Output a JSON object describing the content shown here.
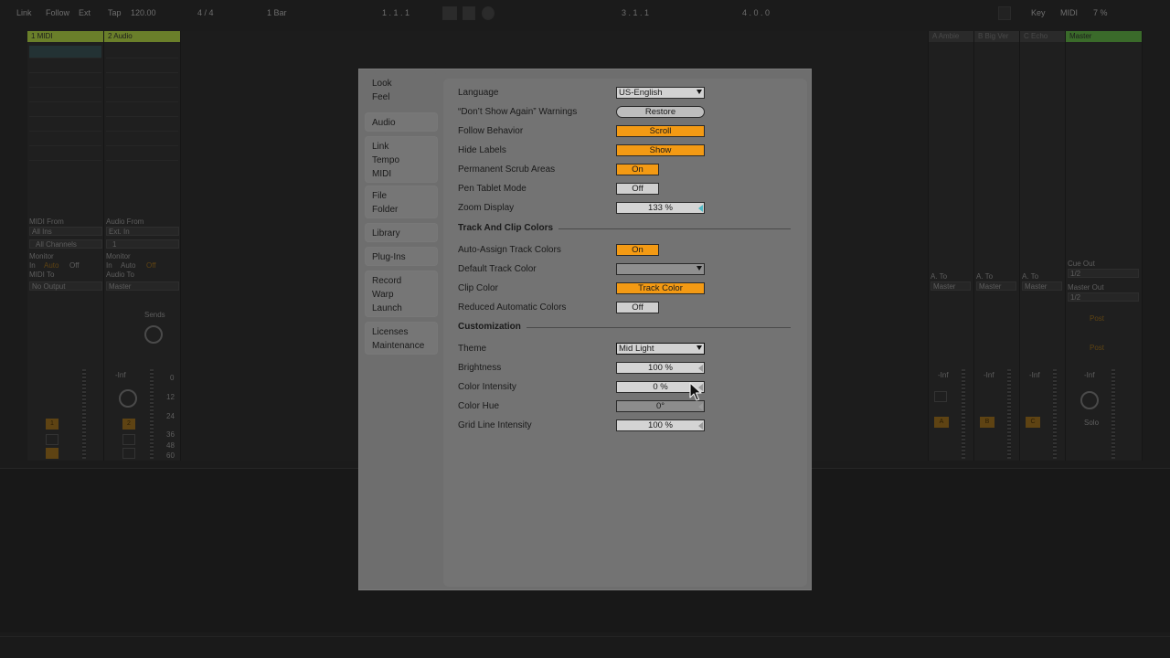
{
  "topbar": {
    "link": "Link",
    "follow": "Follow",
    "ext": "Ext",
    "tap": "Tap",
    "tempo": "120.00",
    "signature": "4 / 4",
    "quantize": "1 Bar",
    "arrangement_position": "1 .   1 .   1",
    "loop_start": "3 .   1 .   1",
    "loop_length": "4 .   0 .   0",
    "key": "Key",
    "midi": "MIDI",
    "cpu": "7 %"
  },
  "tracks": [
    {
      "name": "1 MIDI",
      "color": "#6a7f2a"
    },
    {
      "name": "2 Audio",
      "color": "#6a7f2a"
    },
    {
      "name": "A Ambie",
      "color": "#3f3f3f"
    },
    {
      "name": "B Big Ver",
      "color": "#3f3f3f"
    },
    {
      "name": "C Echo",
      "color": "#3f3f3f"
    },
    {
      "name": "Master",
      "color": "#3a6a2a"
    }
  ],
  "io": {
    "midi_from": "MIDI From",
    "all_ins": "All Ins",
    "all_channels": "All Channels",
    "audio_from": "Audio From",
    "ext_in": "Ext. In",
    "input_channel": "1",
    "monitor": "Monitor",
    "monitor_in": "In",
    "monitor_auto": "Auto",
    "monitor_off": "Off",
    "midi_to": "MIDI To",
    "no_output": "No Output",
    "audio_to": "Audio To",
    "master": "Master",
    "sends": "Sends",
    "cue_out": "Cue Out",
    "cue_out_value": "1/2",
    "master_out": "Master Out",
    "master_out_value": "1/2",
    "a_to": "A. To",
    "inf": "-Inf",
    "post": "Post",
    "solo": "Solo"
  },
  "mixer": {
    "track1_number": "1",
    "track2_number": "2",
    "return_a": "A",
    "return_b": "B",
    "return_c": "C",
    "db_scale": [
      "0",
      "12",
      "24",
      "36",
      "48",
      "60"
    ]
  },
  "dialog": {
    "nav": [
      {
        "lines": [
          "Look",
          "Feel"
        ],
        "boxed": false
      },
      {
        "lines": [
          "Audio"
        ],
        "boxed": true
      },
      {
        "lines": [
          "Link",
          "Tempo",
          "MIDI"
        ],
        "boxed": true
      },
      {
        "lines": [
          "File",
          "Folder"
        ],
        "boxed": true
      },
      {
        "lines": [
          "Library"
        ],
        "boxed": true
      },
      {
        "lines": [
          "Plug-Ins"
        ],
        "boxed": true
      },
      {
        "lines": [
          "Record",
          "Warp",
          "Launch"
        ],
        "boxed": true
      },
      {
        "lines": [
          "Licenses",
          "Maintenance"
        ],
        "boxed": true
      }
    ],
    "settings": {
      "language": {
        "label": "Language",
        "value": "US-English"
      },
      "dont_show": {
        "label": "“Don’t Show Again” Warnings",
        "value": "Restore"
      },
      "follow_behavior": {
        "label": "Follow Behavior",
        "value": "Scroll"
      },
      "hide_labels": {
        "label": "Hide Labels",
        "value": "Show"
      },
      "permanent_scrub": {
        "label": "Permanent Scrub Areas",
        "value": "On"
      },
      "pen_tablet": {
        "label": "Pen Tablet Mode",
        "value": "Off"
      },
      "zoom_display": {
        "label": "Zoom Display",
        "value": "133 %"
      }
    },
    "track_clip_section": "Track And Clip Colors",
    "track_clip": {
      "auto_assign": {
        "label": "Auto-Assign Track Colors",
        "value": "On"
      },
      "default_track_color": {
        "label": "Default Track Color",
        "value": ""
      },
      "clip_color": {
        "label": "Clip Color",
        "value": "Track Color"
      },
      "reduced_auto": {
        "label": "Reduced Automatic Colors",
        "value": "Off"
      }
    },
    "customization_section": "Customization",
    "customization": {
      "theme": {
        "label": "Theme",
        "value": "Mid Light"
      },
      "brightness": {
        "label": "Brightness",
        "value": "100 %"
      },
      "color_intensity": {
        "label": "Color Intensity",
        "value": "0 %"
      },
      "color_hue": {
        "label": "Color Hue",
        "value": "0°"
      },
      "grid_line_intensity": {
        "label": "Grid Line Intensity",
        "value": "100 %"
      }
    }
  },
  "colors": {
    "accent_orange": "#f39a14",
    "slider_teal": "#4fb9c4"
  }
}
